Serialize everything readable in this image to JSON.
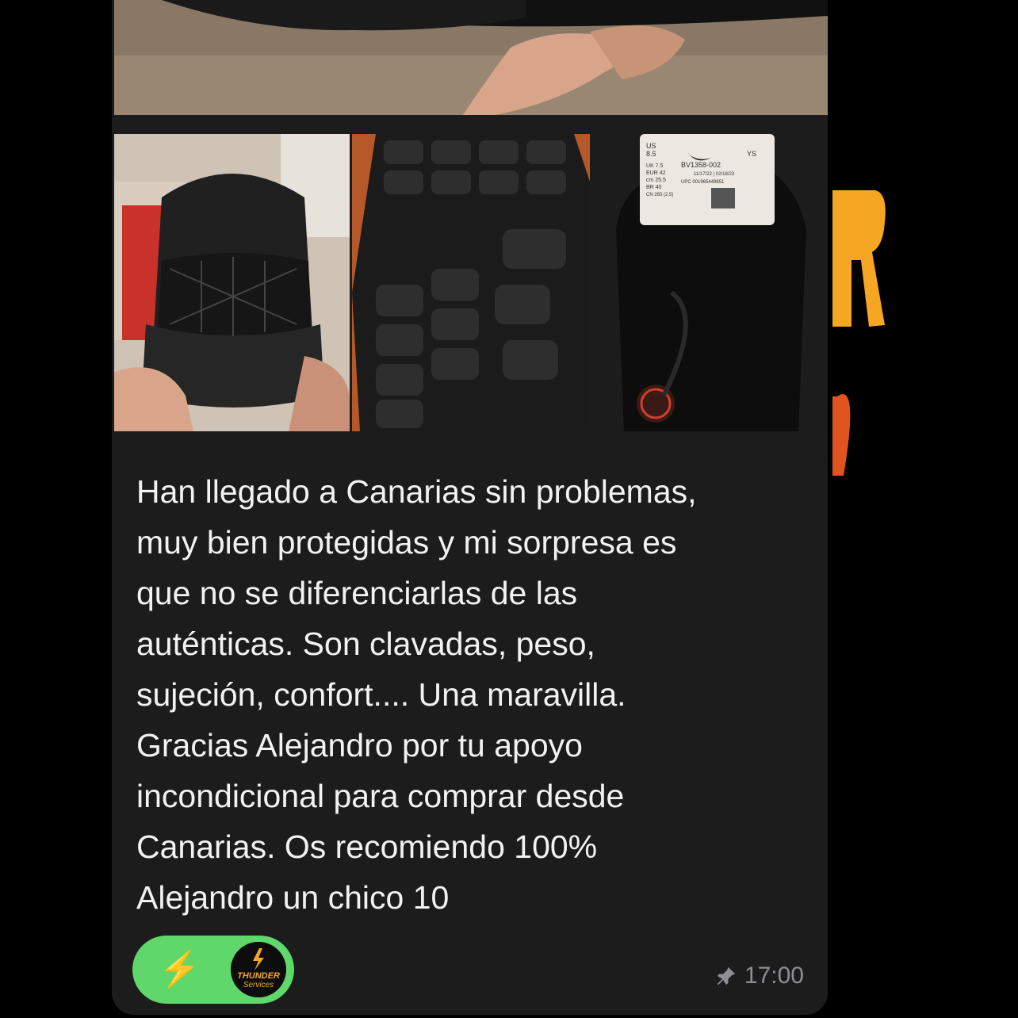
{
  "message": {
    "text": "Han llegado a Canarias sin problemas,\nmuy bien protegidas y mi sorpresa es\nque no se diferenciarlas de las\nauténticas. Son clavadas, peso,\nsujeción, confort.... Una maravilla.\nGracias Alejandro por tu apoyo\nincondicional para comprar desde\nCanarias. Os recomiendo 100%\nAlejandro un chico 10",
    "time": "17:00",
    "pinned": true,
    "reaction_emoji": "⚡",
    "reaction_avatar_text": [
      "THUNDER",
      "Services"
    ]
  },
  "photos": {
    "label_text": [
      "US",
      "8.5",
      "YS",
      "UK 7.5",
      "EUR 42",
      "cm 25.5",
      "BR 40",
      "CN 265 (2.5)",
      "BV1358-002",
      "11/17/22 | 02/18/23",
      "UPC 001965449851"
    ]
  },
  "colors": {
    "bubble": "#1c1c1d",
    "text": "#f2f2f2",
    "reaction_bg": "#5fd76a",
    "meta": "#8e8e93"
  }
}
